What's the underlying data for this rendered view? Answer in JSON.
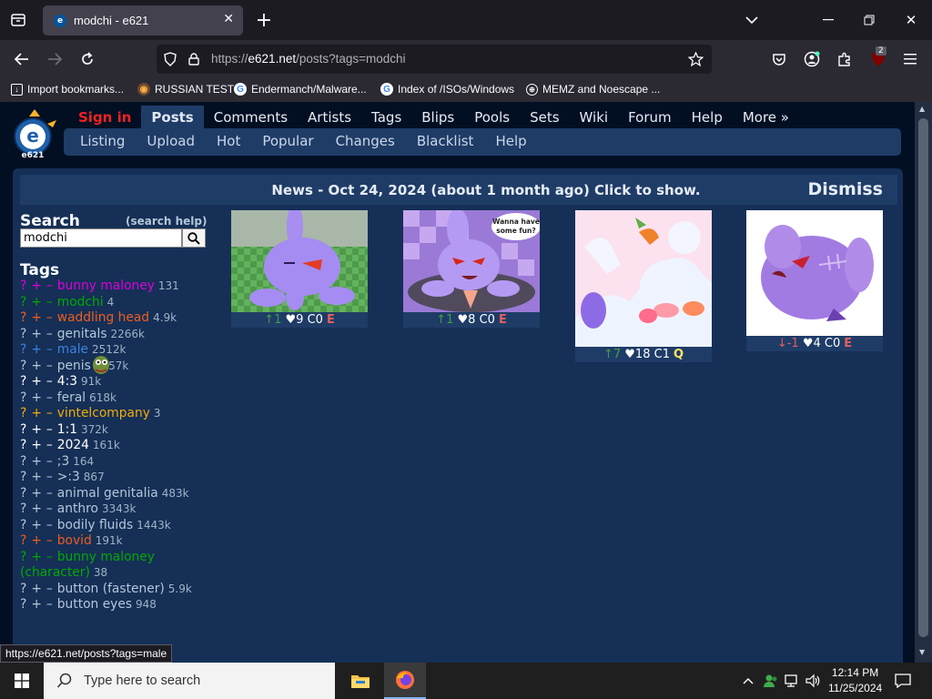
{
  "browser": {
    "tab_title": "modchi - e621",
    "tab_favicon_text": "e",
    "url_prefix": "https://",
    "url_host": "e621.net",
    "url_path": "/posts?tags=modchi",
    "extensions_badge": "2",
    "bookmarks": [
      {
        "label": "Import bookmarks...",
        "icon": "import-icon"
      },
      {
        "label": "RUSSIAN TEST",
        "icon": "russian-test-favicon"
      },
      {
        "label": "Endermanch/Malware...",
        "icon": "google-icon"
      },
      {
        "label": "Index of /ISOs/Windows",
        "icon": "google-icon"
      },
      {
        "label": "MEMZ and Noescape ...",
        "icon": "globe-icon"
      }
    ],
    "status_url": "https://e621.net/posts?tags=male"
  },
  "site": {
    "logo_text": "e621",
    "main_nav": [
      "Sign in",
      "Posts",
      "Comments",
      "Artists",
      "Tags",
      "Blips",
      "Pools",
      "Sets",
      "Wiki",
      "Forum",
      "Help",
      "More »"
    ],
    "sub_nav": [
      "Listing",
      "Upload",
      "Hot",
      "Popular",
      "Changes",
      "Blacklist",
      "Help"
    ],
    "news_text": "News - Oct 24, 2024 (about 1 month ago) Click to show.",
    "dismiss": "Dismiss",
    "search_heading": "Search",
    "search_help": "(search help)",
    "search_value": "modchi",
    "tags_heading": "Tags",
    "tag_q": "?",
    "tag_plus": "+",
    "tag_minus": "–"
  },
  "tags": [
    {
      "name": "bunny maloney",
      "count": "131",
      "type": "copy"
    },
    {
      "name": "modchi",
      "count": "4",
      "type": "char"
    },
    {
      "name": "waddling head",
      "count": "4.9k",
      "type": "spec"
    },
    {
      "name": "genitals",
      "count": "2266k",
      "type": "gen"
    },
    {
      "name": "male",
      "count": "2512k",
      "type": "male"
    },
    {
      "name": "penis",
      "count": "1557k",
      "type": "gen"
    },
    {
      "name": "4:3",
      "count": "91k",
      "type": "gen2"
    },
    {
      "name": "feral",
      "count": "618k",
      "type": "gen"
    },
    {
      "name": "vintelcompany",
      "count": "3",
      "type": "artist"
    },
    {
      "name": "1:1",
      "count": "372k",
      "type": "gen2"
    },
    {
      "name": "2024",
      "count": "161k",
      "type": "gen2"
    },
    {
      "name": ";3",
      "count": "164",
      "type": "gen"
    },
    {
      "name": ">:3",
      "count": "867",
      "type": "gen"
    },
    {
      "name": "animal genitalia",
      "count": "483k",
      "type": "gen"
    },
    {
      "name": "anthro",
      "count": "3343k",
      "type": "gen"
    },
    {
      "name": "bodily fluids",
      "count": "1443k",
      "type": "gen"
    },
    {
      "name": "bovid",
      "count": "191k",
      "type": "spec"
    },
    {
      "name": "bunny maloney (character)",
      "count": "38",
      "type": "char",
      "wrap": true
    },
    {
      "name": "button (fastener)",
      "count": "5.9k",
      "type": "gen",
      "wrap": true
    },
    {
      "name": "button eyes",
      "count": "948",
      "type": "gen"
    }
  ],
  "posts": [
    {
      "dir": "↑",
      "score": "1",
      "favs": "♥9",
      "comments": "C0",
      "rating": "E",
      "rating_color": "#e45f5f"
    },
    {
      "dir": "↑",
      "score": "1",
      "favs": "♥8",
      "comments": "C0",
      "rating": "E",
      "rating_color": "#e45f5f"
    },
    {
      "dir": "↑",
      "score": "7",
      "favs": "♥18",
      "comments": "C1",
      "rating": "Q",
      "rating_color": "#ffe666"
    },
    {
      "dir": "↓",
      "score": "-1",
      "favs": "♥4",
      "comments": "C0",
      "rating": "E",
      "rating_color": "#e45f5f"
    }
  ],
  "post_images": [
    {
      "bubble": ""
    },
    {
      "bubble": "Wanna have some fun?"
    },
    {
      "bubble": ""
    },
    {
      "bubble": ""
    }
  ],
  "taskbar": {
    "search_placeholder": "Type here to search",
    "time": "12:14 PM",
    "date": "11/25/2024"
  },
  "colors": {
    "page_bg": "#020f23",
    "content_bg": "#152f56",
    "nav_bg": "#1f3c67",
    "signin": "#ee2222"
  }
}
